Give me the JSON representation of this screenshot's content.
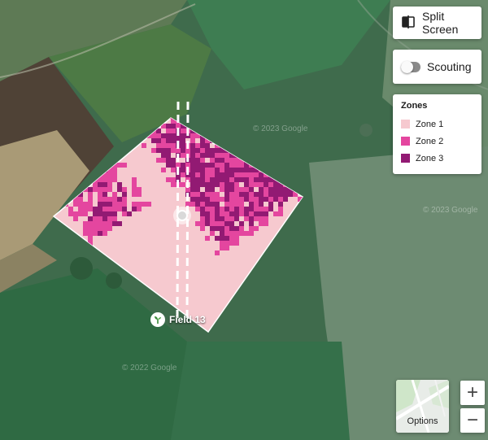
{
  "toolbar": {
    "split_screen_label": "Split Screen",
    "scouting_label": "Scouting",
    "scouting_enabled": false
  },
  "legend": {
    "title": "Zones",
    "zones": [
      {
        "label": "Zone 1",
        "color": "#f6c9cf"
      },
      {
        "label": "Zone 2",
        "color": "#e4469f"
      },
      {
        "label": "Zone 3",
        "color": "#921a73"
      }
    ]
  },
  "field": {
    "name": "Field 13"
  },
  "map": {
    "options_label": "Options",
    "zoom_in_label": "+",
    "zoom_out_label": "−",
    "watermark": "© 2023 Google",
    "watermark_alt": "© 2022 Google"
  }
}
